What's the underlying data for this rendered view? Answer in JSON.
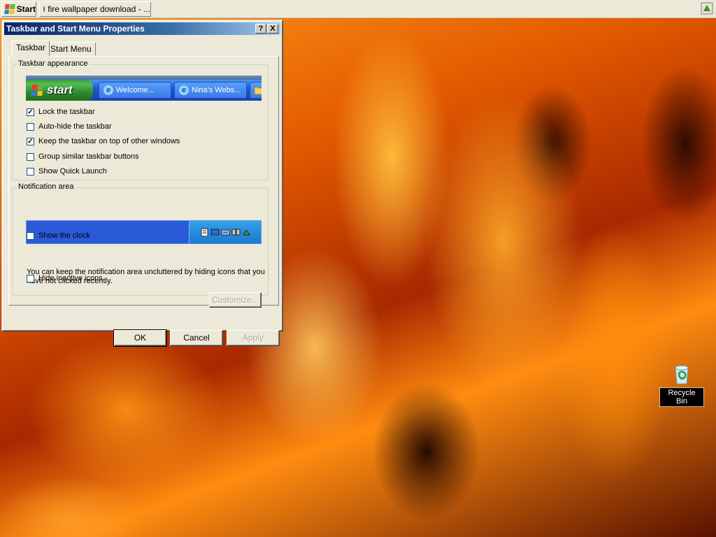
{
  "taskbar": {
    "start_label": "Start",
    "window_button_label": "fire wallpaper download - ..."
  },
  "dialog": {
    "title": "Taskbar and Start Menu Properties",
    "help_label": "?",
    "close_label": "X",
    "tabs": [
      {
        "label": "Taskbar",
        "selected": true
      },
      {
        "label": "Start Menu",
        "selected": false
      }
    ],
    "appearance": {
      "legend": "Taskbar appearance",
      "preview": {
        "start_label": "start",
        "tasks": [
          "Welcome...",
          "Nina's Webs..."
        ]
      },
      "options": [
        {
          "label": "Lock the taskbar",
          "checked": true
        },
        {
          "label": "Auto-hide the taskbar",
          "checked": false
        },
        {
          "label": "Keep the taskbar on top of other windows",
          "checked": true
        },
        {
          "label": "Group similar taskbar buttons",
          "checked": false
        },
        {
          "label": "Show Quick Launch",
          "checked": false
        }
      ]
    },
    "notification": {
      "legend": "Notification area",
      "show_clock": {
        "label": "Show the clock",
        "checked": false
      },
      "description": "You can keep the notification area uncluttered by hiding icons that you have not clicked recently.",
      "hide_inactive": {
        "label": "Hide inactive icons",
        "checked": false
      },
      "customize_label": "Customize..."
    },
    "buttons": {
      "ok": "OK",
      "cancel": "Cancel",
      "apply": "Apply"
    }
  },
  "desktop": {
    "recycle_bin_label": "Recycle Bin"
  },
  "colors": {
    "titlebar_start": "#0a246a",
    "titlebar_end": "#a6caf0",
    "dialog_face": "#ece9d8",
    "xp_blue": "#2157d7",
    "xp_green": "#3a9a3a"
  }
}
